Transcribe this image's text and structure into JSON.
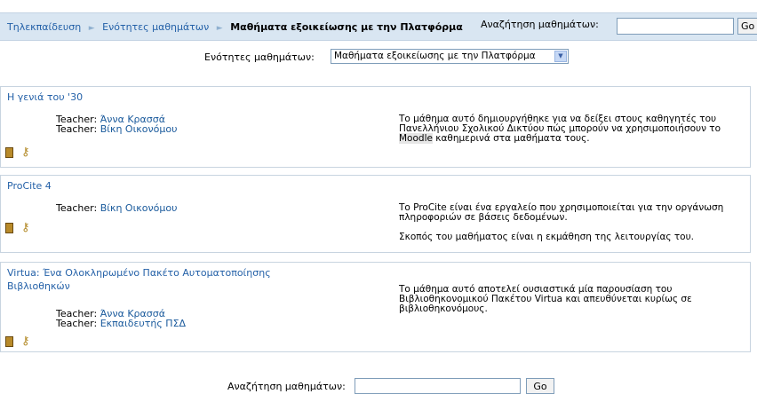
{
  "breadcrumb": {
    "items": [
      "Τηλεκπαίδευση",
      "Ενότητες μαθημάτων"
    ],
    "separator": "►",
    "current": "Μαθήματα εξοικείωσης με την Πλατφόρμα"
  },
  "nav_search": {
    "label": "Αναζήτηση μαθημάτων:",
    "value": "",
    "button": "Go"
  },
  "category": {
    "label": "Ενότητες μαθημάτων:",
    "selected": "Μαθήματα εξοικείωσης με την Πλατφόρμα"
  },
  "teacher_label": "Teacher:",
  "courses": [
    {
      "title": "Η γενιά του '30",
      "teachers": [
        "Άννα Κρασσά",
        "Βίκη Οικονόμου"
      ],
      "summary_before": "Το μάθημα αυτό δημιουργήθηκε για να δείξει στους καθηγητές του Πανελλήνιου Σχολικού Δικτύου πώς μπορούν να χρησιμοποιήσουν το ",
      "summary_highlight": "Moodle",
      "summary_after": " καθημερινά στα μαθήματα τους."
    },
    {
      "title": "ProCite 4",
      "teachers": [
        "Βίκη Οικονόμου"
      ],
      "summary_p1": "Το ProCite είναι ένα εργαλείο που χρησιμοποιείται για την οργάνωση πληροφοριών σε βάσεις δεδομένων.",
      "summary_p2": "Σκοπός του μαθήματος είναι η εκμάθηση της λειτουργίας του."
    },
    {
      "title": "Virtua: Ένα Ολοκληρωμένο Πακέτο Αυτοματοποίησης Βιβλιοθηκών",
      "teachers": [
        "Άννα Κρασσά",
        "Εκπαιδευτής ΠΣΔ"
      ],
      "summary": "Το μάθημα αυτό αποτελεί ουσιαστικά μία παρουσίαση του Βιβλιοθηκονομικού Πακέτου Virtua και απευθύνεται κυρίως σε βιβλιοθηκονόμους."
    }
  ],
  "icons": {
    "guest": "door-icon",
    "enrol_key": "key-icon"
  },
  "bottom_search": {
    "label": "Αναζήτηση μαθημάτων:",
    "value": "",
    "button": "Go"
  },
  "colors": {
    "navbar_bg": "#d9e6f2",
    "link": "#2461a8",
    "border": "#c8d4e0"
  }
}
